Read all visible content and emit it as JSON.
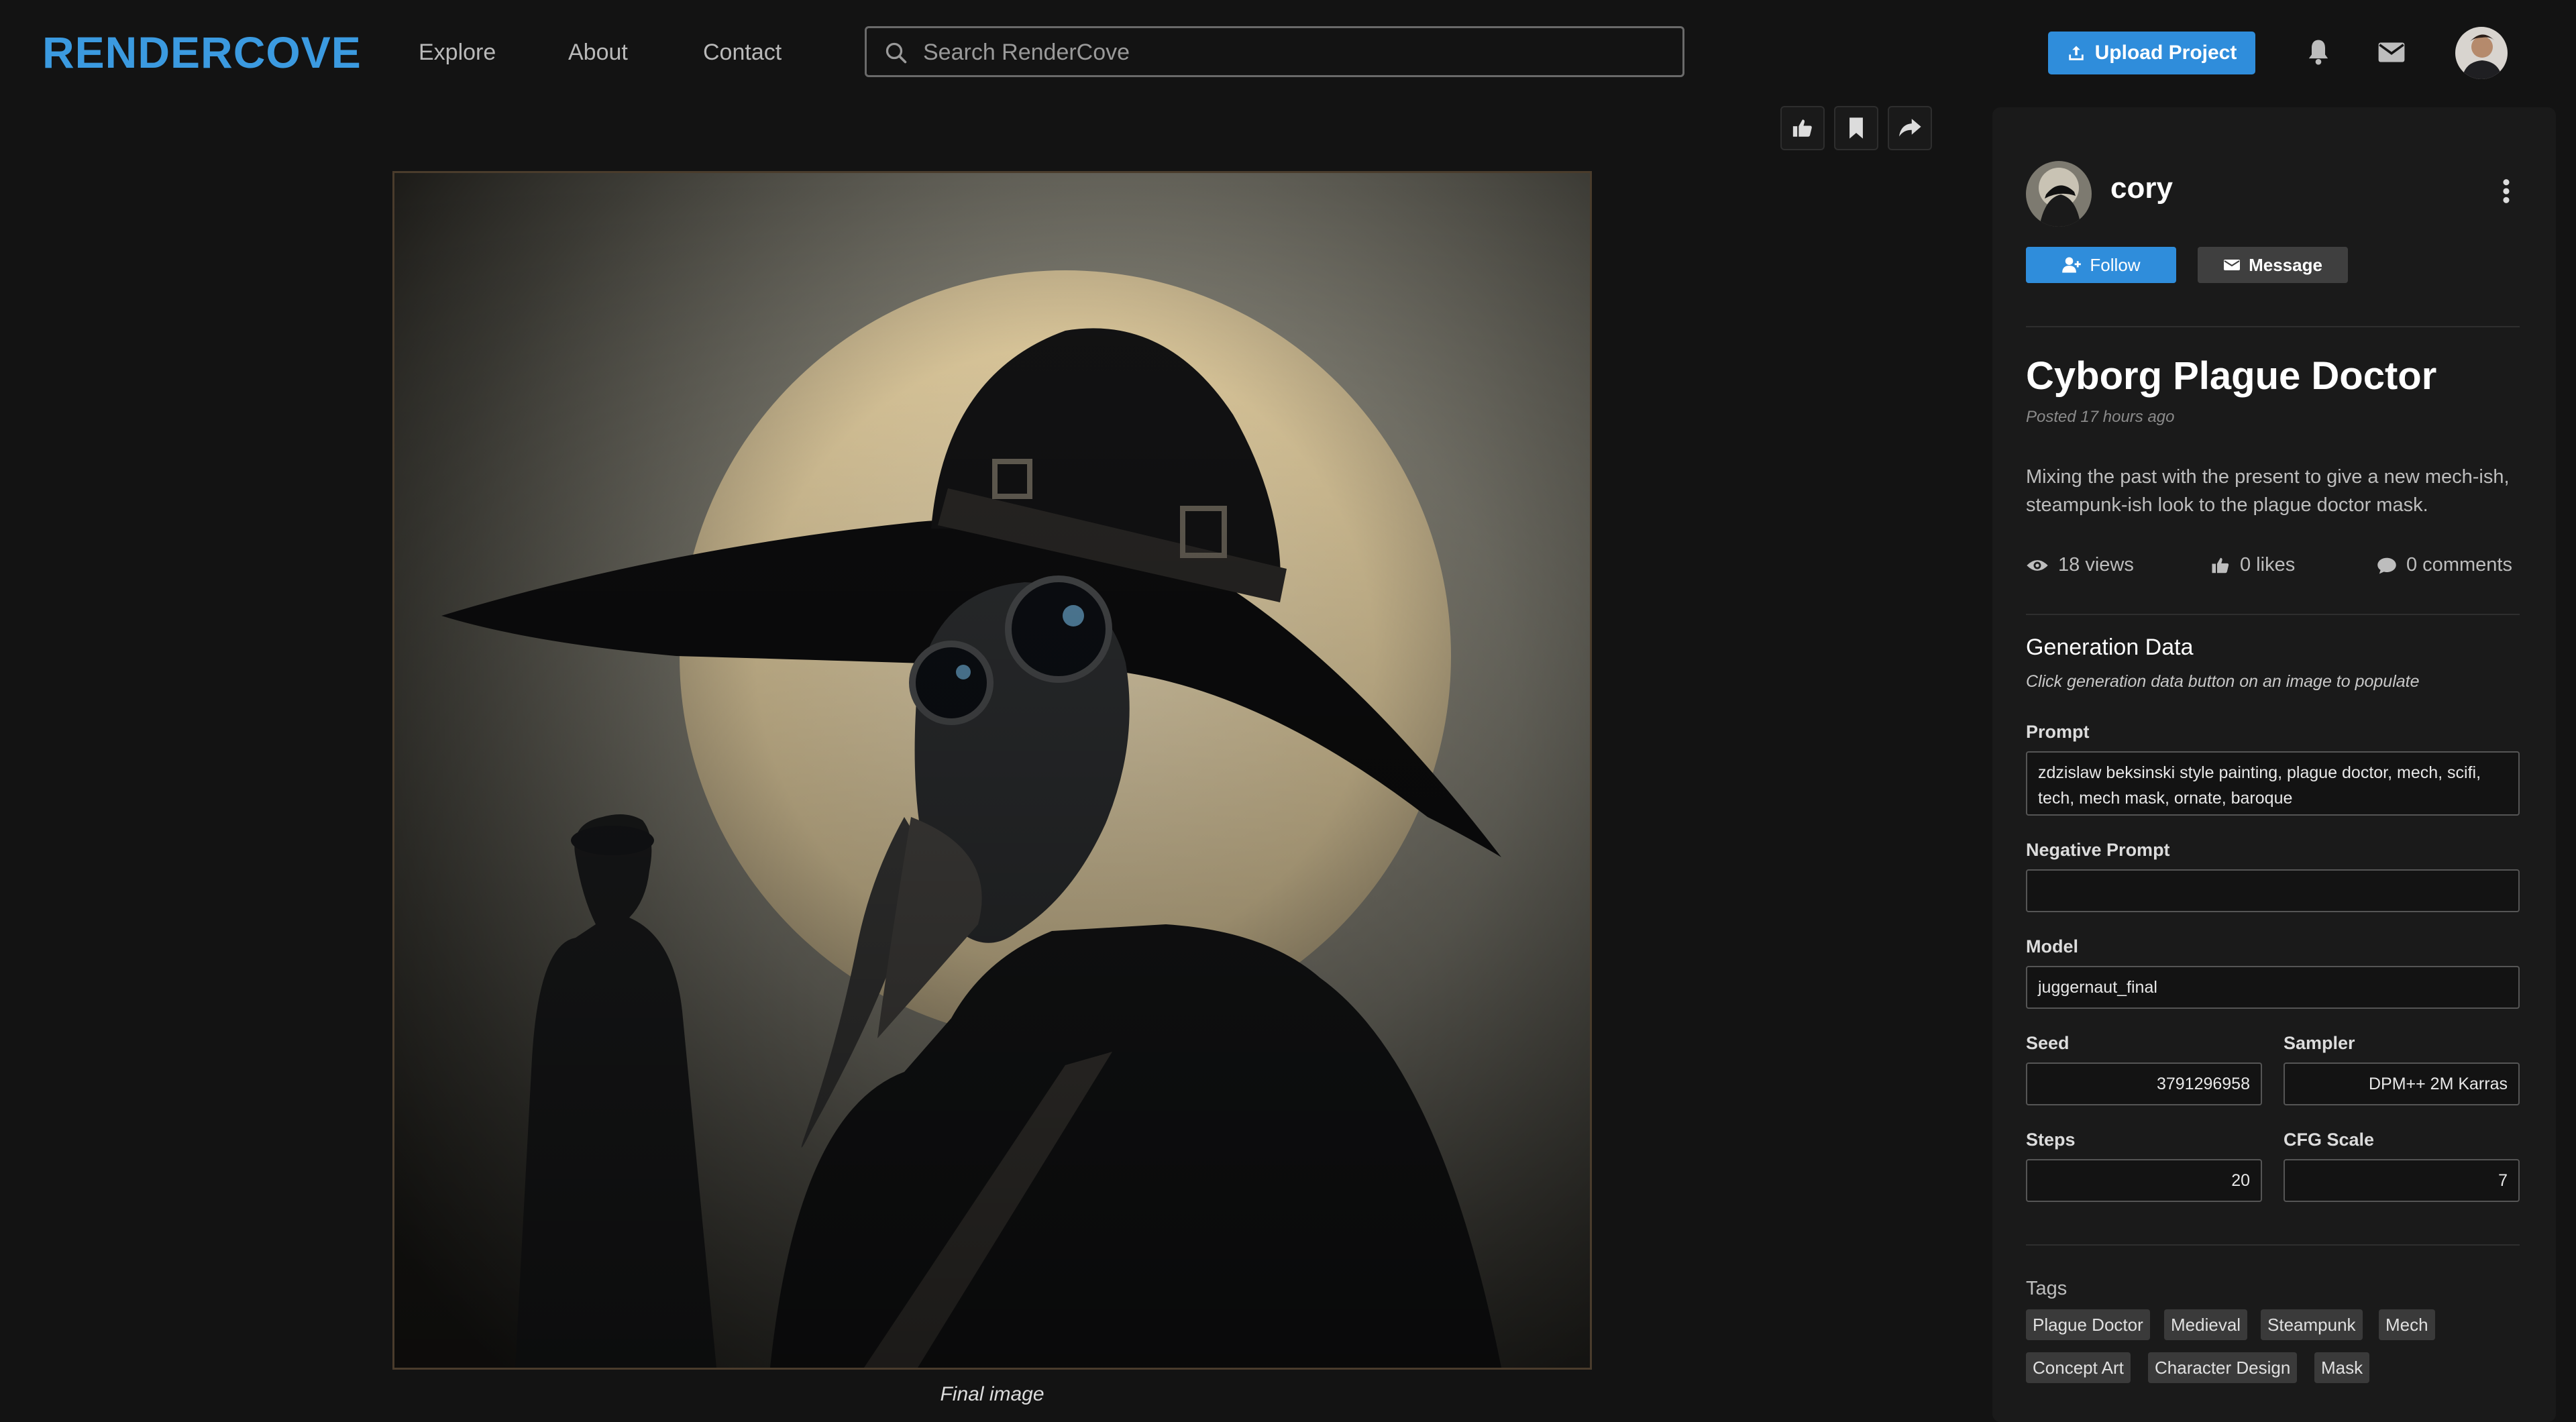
{
  "header": {
    "logo": "RENDERCOVE",
    "nav": [
      "Explore",
      "About",
      "Contact"
    ],
    "search_placeholder": "Search RenderCove",
    "upload_label": "Upload Project"
  },
  "project": {
    "author": "cory",
    "follow_label": "Follow",
    "message_label": "Message",
    "title": "Cyborg Plague Doctor",
    "posted": "Posted 17 hours ago",
    "description": "Mixing the past with the present to give a new mech-ish, steampunk-ish look to the plague doctor mask.",
    "views": "18 views",
    "likes": "0 likes",
    "comments": "0 comments",
    "caption": "Final image"
  },
  "generation": {
    "heading": "Generation Data",
    "hint": "Click generation data button on an image to populate",
    "prompt_label": "Prompt",
    "prompt": "zdzislaw beksinski style painting, plague doctor, mech, scifi, tech, mech mask, ornate, baroque",
    "negative_label": "Negative Prompt",
    "negative": "",
    "model_label": "Model",
    "model": "juggernaut_final",
    "seed_label": "Seed",
    "seed": "3791296958",
    "sampler_label": "Sampler",
    "sampler": "DPM++ 2M Karras",
    "steps_label": "Steps",
    "steps": "20",
    "cfg_label": "CFG Scale",
    "cfg": "7"
  },
  "tags": {
    "label": "Tags",
    "items": [
      "Plague Doctor",
      "Medieval",
      "Steampunk",
      "Mech",
      "Concept Art",
      "Character Design",
      "Mask"
    ]
  },
  "colors": {
    "accent": "#2f8ddb",
    "logo": "#3b9ae0",
    "background": "#131313",
    "panel": "#1a1a1a"
  },
  "icons": [
    "search-icon",
    "upload-icon",
    "bell-icon",
    "mail-icon",
    "thumbs-up-icon",
    "bookmark-icon",
    "share-icon",
    "kebab-icon",
    "user-plus-icon",
    "envelope-icon",
    "eye-icon",
    "comment-icon"
  ]
}
